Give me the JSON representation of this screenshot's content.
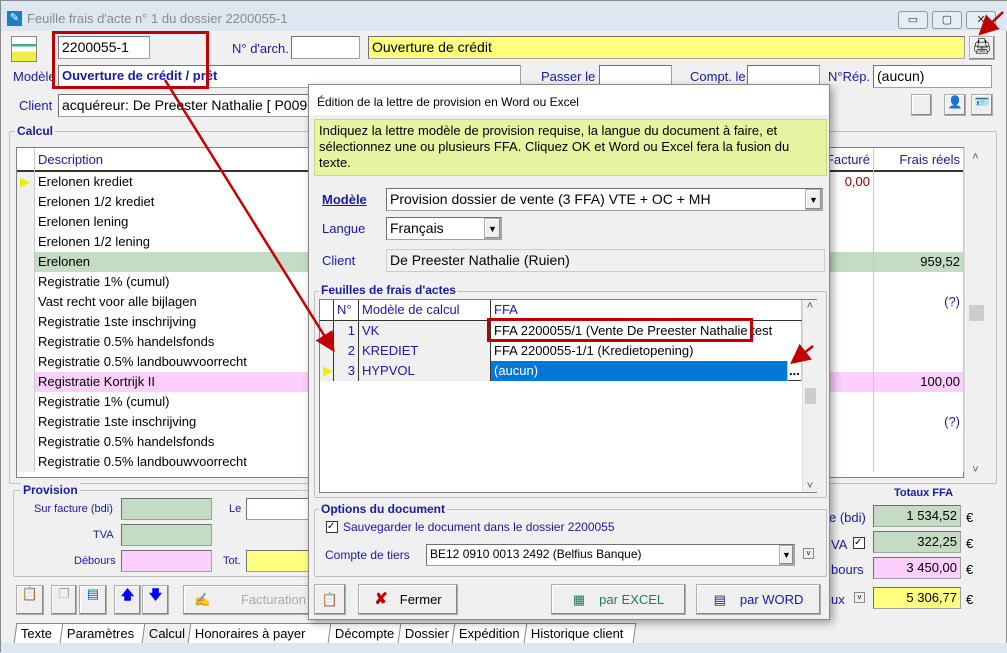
{
  "window": {
    "title": "Feuille frais d'acte n° 1 du dossier 2200055-1",
    "min": "▭",
    "max": "▢",
    "close": "✕"
  },
  "header": {
    "dossier": "2200055-1",
    "arch_label": "N° d'arch.",
    "arch_value": "",
    "objet": "Ouverture de crédit",
    "modele_label": "Modèle",
    "modele_value": "Ouverture de crédit / prêt",
    "passer_label": "Passer le",
    "passer_value": "",
    "compt_label": "Compt. le",
    "compt_value": "",
    "nrep_label": "N°Rép.",
    "nrep_value": "(aucun)",
    "client_label": "Client",
    "client_value": "acquéreur: De Preester Nathalie [ P00966 ]"
  },
  "calcul": {
    "title": "Calcul",
    "columns": {
      "description": "Description",
      "facture": "Facturé",
      "frais": "Frais réels"
    },
    "rows": [
      {
        "d": "Erelonen krediet",
        "f": "0,00",
        "r": "",
        "c": "",
        "cur": true
      },
      {
        "d": "Erelonen 1/2 krediet",
        "f": "",
        "r": "",
        "c": ""
      },
      {
        "d": "Erelonen lening",
        "f": "",
        "r": "",
        "c": ""
      },
      {
        "d": "Erelonen 1/2 lening",
        "f": "",
        "r": "",
        "c": ""
      },
      {
        "d": "Erelonen",
        "f": "",
        "r": "959,52",
        "c": "#c4dcc4"
      },
      {
        "d": "Registratie 1% (cumul)",
        "f": "",
        "r": "",
        "c": ""
      },
      {
        "d": "Vast recht voor alle bijlagen",
        "f": "",
        "r": "(?)",
        "c": ""
      },
      {
        "d": "Registratie 1ste inschrijving",
        "f": "",
        "r": "",
        "c": ""
      },
      {
        "d": "Registratie 0.5% handelsfonds",
        "f": "",
        "r": "",
        "c": ""
      },
      {
        "d": "Registratie 0.5% landbouwvoorrecht",
        "f": "",
        "r": "",
        "c": ""
      },
      {
        "d": "Registratie Kortrijk II",
        "f": "",
        "r": "100,00",
        "c": "#fccffc"
      },
      {
        "d": "Registratie 1% (cumul)",
        "f": "",
        "r": "",
        "c": ""
      },
      {
        "d": "Registratie 1ste inschrijving",
        "f": "",
        "r": "(?)",
        "c": ""
      },
      {
        "d": "Registratie 0.5% handelsfonds",
        "f": "",
        "r": "",
        "c": ""
      },
      {
        "d": "Registratie 0.5% landbouwvoorrecht",
        "f": "",
        "r": "",
        "c": ""
      }
    ]
  },
  "provision": {
    "title": "Provision",
    "sur_facture": "Sur facture (bdi)",
    "tva": "TVA",
    "debours": "Débours",
    "le": "Le",
    "tot": "Tot."
  },
  "totaux": {
    "title": "Totaux FFA",
    "label1": "e (bdi)",
    "v1": "1 534,52",
    "label2": "VA",
    "v2": "322,25",
    "label3": "bours",
    "v3": "3 450,00",
    "label4": "ux",
    "v4": "5 306,77",
    "currency": "€"
  },
  "toolbar": {
    "facturation": "Facturation"
  },
  "tabs": [
    "Texte",
    "Paramètres",
    "Calcul",
    "Honoraires à payer",
    "Décompte",
    "Dossier",
    "Expédition",
    "Historique client"
  ],
  "dialog": {
    "title": "Édition de la lettre de provision en Word ou Excel",
    "info": "Indiquez la lettre modèle de provision requise, la langue du document à faire, et sélectionnez une ou plusieurs FFA.  Cliquez OK et Word ou Excel fera la fusion du texte.",
    "modele_label": "Modèle",
    "modele_value": "Provision dossier de vente (3 FFA) VTE + OC + MH",
    "langue_label": "Langue",
    "langue_value": "Français",
    "client_label": "Client",
    "client_value": "De Preester Nathalie (Ruien)",
    "ffa_group": "Feuilles de frais d'actes",
    "ffa_cols": {
      "n": "N°",
      "modele": "Modèle de calcul",
      "ffa": "FFA"
    },
    "ffa_rows": [
      {
        "n": "1",
        "m": "VK",
        "f": "FFA 2200055/1 (Vente De Preester Nathalie test"
      },
      {
        "n": "2",
        "m": "KREDIET",
        "f": "FFA 2200055-1/1 (Kredietopening)"
      },
      {
        "n": "3",
        "m": "HYPVOL",
        "f": "(aucun)"
      }
    ],
    "ellipsis": "...",
    "options_group": "Options du document",
    "save_label": "Sauvegarder le document dans le dossier 2200055",
    "save_checked": true,
    "compte_label": "Compte de tiers",
    "compte_value": "BE12 0910 0013 2492 (Belfius Banque)",
    "fermer": "Fermer",
    "excel": "par EXCEL",
    "word": "par WORD"
  },
  "colors": {
    "accent_yellow": "#ffff80",
    "green": "#c4dcc4",
    "pink": "#fccffc",
    "info_bg": "#e4f4a0",
    "selection": "#0078d7",
    "annotation": "#c00000"
  }
}
